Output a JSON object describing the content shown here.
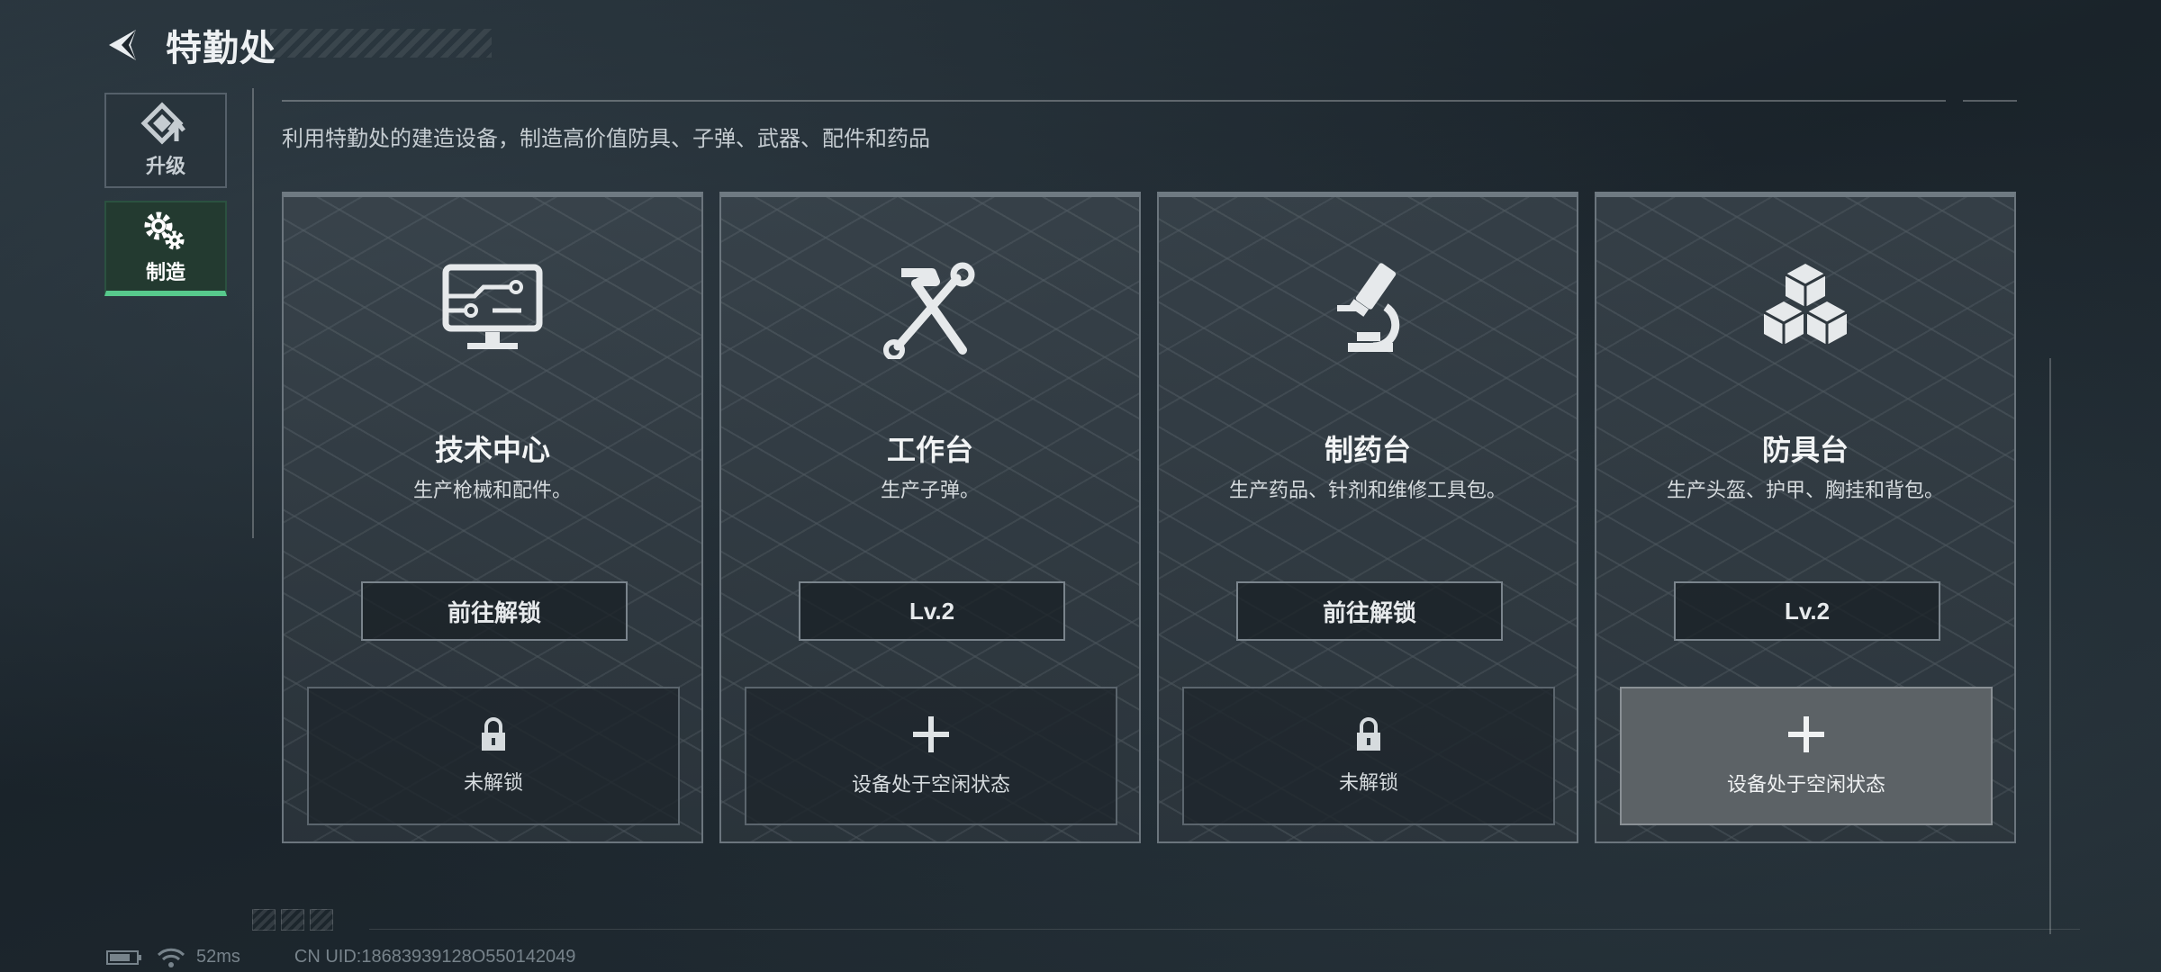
{
  "header": {
    "title": "特勤处"
  },
  "sidebar": {
    "items": [
      {
        "label": "升级",
        "icon": "upgrade-icon",
        "active": false
      },
      {
        "label": "制造",
        "icon": "gears-icon",
        "active": true
      }
    ]
  },
  "description": "利用特勤处的建造设备，制造高价值防具、子弹、武器、配件和药品",
  "cards": [
    {
      "name": "技术中心",
      "desc": "生产枪械和配件。",
      "button": "前往解锁",
      "slot_text": "未解锁",
      "icon": "monitor-circuit-icon",
      "slot_icon": "lock-icon"
    },
    {
      "name": "工作台",
      "desc": "生产子弹。",
      "button": "Lv.2",
      "slot_text": "设备处于空闲状态",
      "icon": "hammer-wrench-icon",
      "slot_icon": "plus-icon"
    },
    {
      "name": "制药台",
      "desc": "生产药品、针剂和维修工具包。",
      "button": "前往解锁",
      "slot_text": "未解锁",
      "icon": "microscope-icon",
      "slot_icon": "lock-icon"
    },
    {
      "name": "防具台",
      "desc": "生产头盔、护甲、胸挂和背包。",
      "button": "Lv.2",
      "slot_text": "设备处于空闲状态",
      "icon": "cubes-icon",
      "slot_icon": "plus-icon"
    }
  ],
  "status": {
    "ping": "52ms",
    "uid": "CN UID:18683939128O550142049"
  },
  "colors": {
    "accent": "#57c98c",
    "background": "#1c252c"
  }
}
